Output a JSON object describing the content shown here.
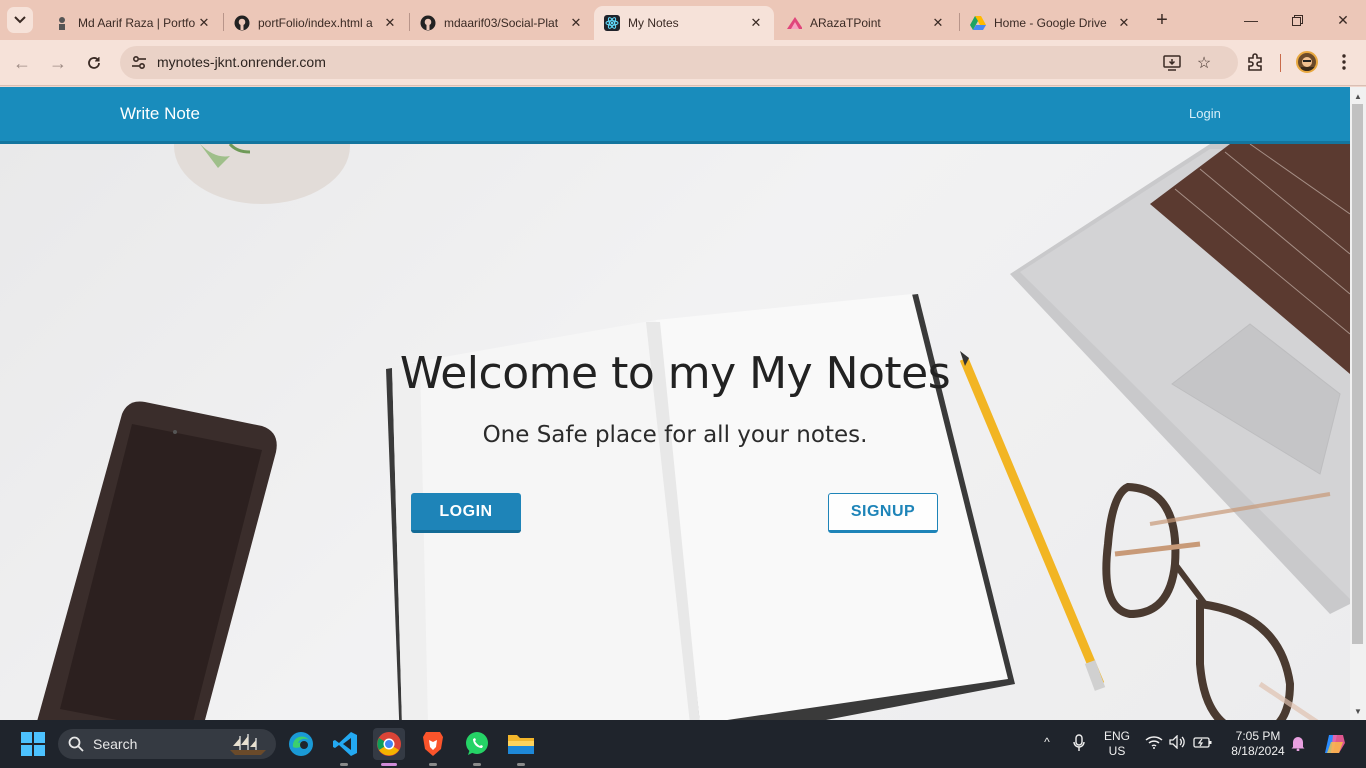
{
  "browser": {
    "tabs": [
      {
        "title": "Md Aarif Raza | Portfo",
        "icon": "person-favicon"
      },
      {
        "title": "portFolio/index.html a",
        "icon": "github-icon"
      },
      {
        "title": "mdaarif03/Social-Plat",
        "icon": "github-icon"
      },
      {
        "title": "My Notes",
        "icon": "react-icon",
        "active": true
      },
      {
        "title": "ARazaTPoint",
        "icon": "arazatpoint-icon"
      },
      {
        "title": "Home - Google Drive",
        "icon": "google-drive-icon"
      }
    ],
    "url": "mynotes-jknt.onrender.com"
  },
  "page": {
    "navbar": {
      "brand": "Write Note",
      "login_link": "Login"
    },
    "hero": {
      "title": "Welcome to my My Notes",
      "subtitle": "One Safe place for all your notes.",
      "login_button": "LOGIN",
      "signup_button": "SIGNUP"
    }
  },
  "taskbar": {
    "search_label": "Search",
    "language_top": "ENG",
    "language_bottom": "US",
    "time": "7:05 PM",
    "date": "8/18/2024"
  },
  "colors": {
    "navbar": "#198cbc",
    "button": "#1e84b8",
    "browser_frame": "#ecc7b8"
  }
}
